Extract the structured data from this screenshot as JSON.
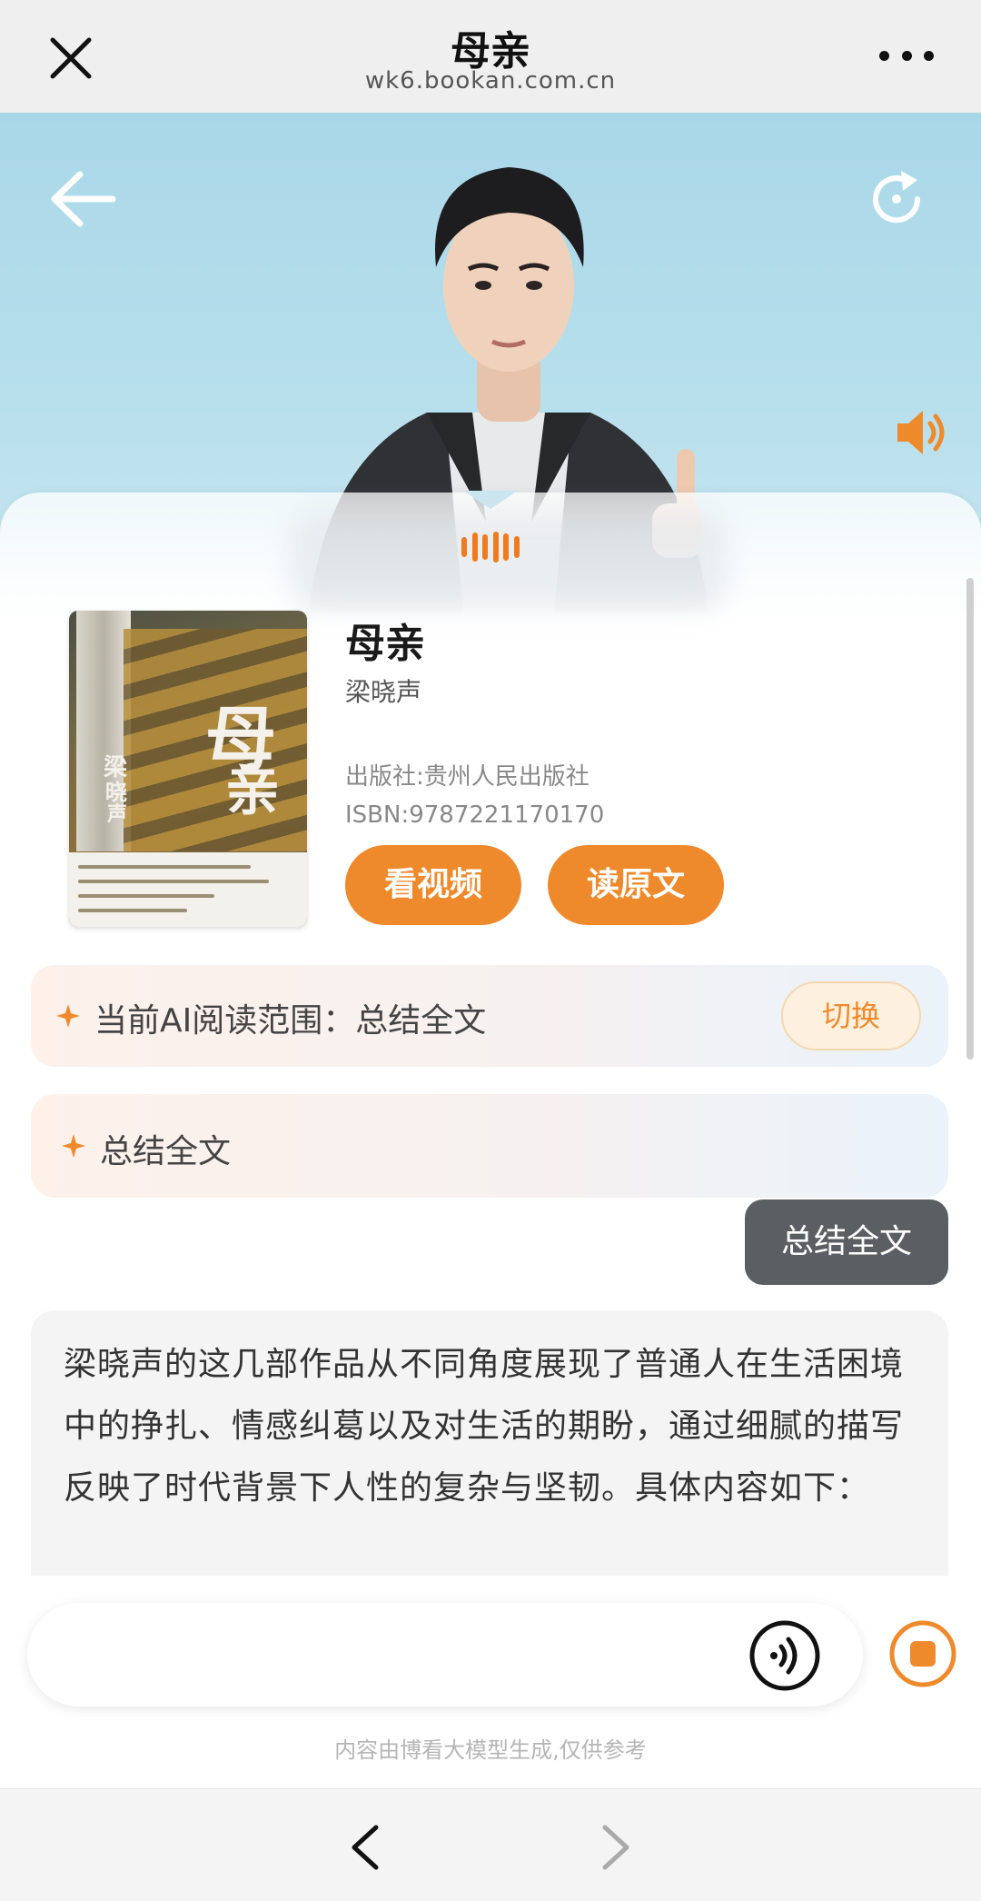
{
  "topbar": {
    "title": "母亲",
    "url": "wk6.bookan.com.cn",
    "close_icon": "close-icon",
    "more_icon": "more-icon"
  },
  "hero": {
    "back_icon": "arrow-left-icon",
    "refresh_icon": "refresh-icon",
    "speaker_icon": "speaker-icon"
  },
  "book": {
    "title": "母亲",
    "author": "梁晓声",
    "publisher": "出版社:贵州人民出版社",
    "isbn": "ISBN:9787221170170",
    "cover": {
      "title_chars": [
        "母",
        "亲"
      ],
      "author_chars": [
        "梁",
        "晓",
        "声"
      ]
    },
    "watch_video_label": "看视频",
    "read_original_label": "读原文"
  },
  "ai_range": {
    "label": "当前AI阅读范围：总结全文",
    "switch_label": "切换"
  },
  "suggestion": {
    "label": "总结全文"
  },
  "chat": {
    "user_message": "总结全文",
    "answer_text": "梁晓声的这几部作品从不同角度展现了普通人在生活困境中的挣扎、情感纠葛以及对生活的期盼，通过细腻的描写反映了时代背景下人性的复杂与坚韧。具体内容如下："
  },
  "input": {
    "value": "",
    "placeholder": ""
  },
  "disclaimer": "内容由博看大模型生成,仅供参考",
  "colors": {
    "accent": "#ef8a2c",
    "bubble": "#5b5f64",
    "hero_bg": "#b7dfec",
    "nav_bg": "#f4f4f4"
  }
}
